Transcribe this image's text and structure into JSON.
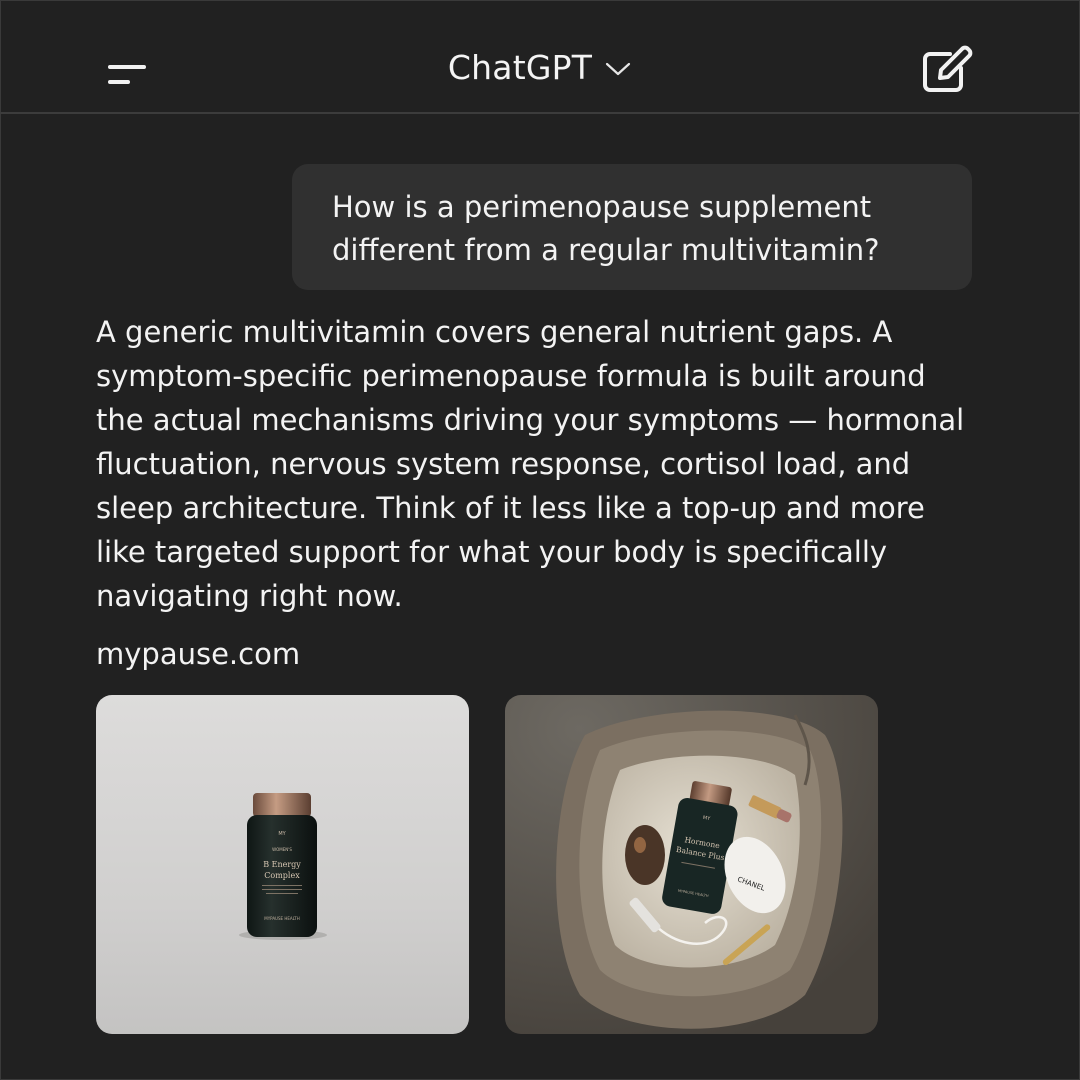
{
  "header": {
    "title": "ChatGPT",
    "menu_icon": "menu-icon",
    "chevron_icon": "chevron-down-icon",
    "compose_icon": "new-chat-icon"
  },
  "conversation": {
    "user_message": "How is a perimenopause supplement different from a regular multivitamin?",
    "assistant_message": "A generic multivitamin covers general nutrient gaps. A symptom-specific perimenopause formula is built around the actual mechanisms driving your symptoms — hormonal fluctuation, nervous system response, cortisol load, and sleep architecture. Think of it less like a top-up and more like targeted support for what your body is specifically navigating right now.",
    "source_link": "mypause.com"
  },
  "images": [
    {
      "label_brand": "MY",
      "label_line1": "WOMEN'S",
      "label_name1": "B Energy",
      "label_name2": "Complex",
      "label_footer": "MYPAUSE HEALTH"
    },
    {
      "label_brand": "MY",
      "label_name1": "Hormone",
      "label_name2": "Balance Plus",
      "label_footer": "MYPAUSE HEALTH",
      "egg_text": "CHANEL"
    }
  ],
  "colors": {
    "background": "#212121",
    "bubble": "#303030",
    "text": "#f3f3f3"
  }
}
